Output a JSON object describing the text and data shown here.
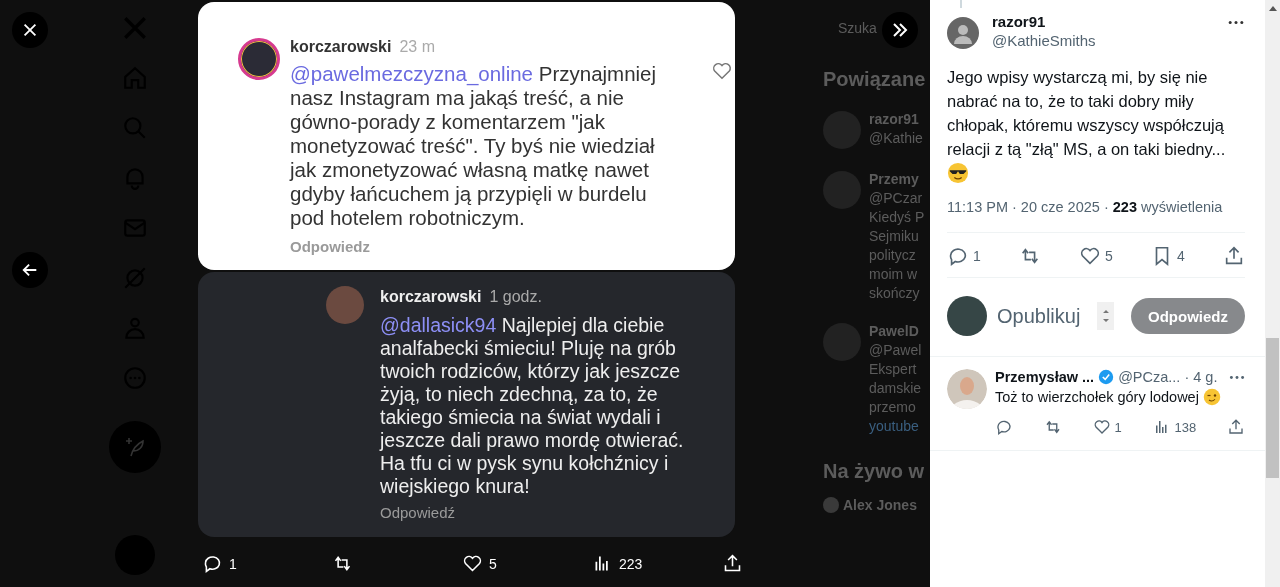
{
  "background": {
    "search_placeholder": "Szuka",
    "related_title": "Powiązane",
    "related": [
      {
        "name": "razor91",
        "handle": "@Kathie"
      },
      {
        "name": "Przemy",
        "handle": "@PCzar",
        "lines": [
          "Kiedyś P",
          "Sejmiku",
          "politycz",
          "moim w",
          "skończy"
        ]
      },
      {
        "name": "PawelD",
        "handle": "@Pawel",
        "lines": [
          "Ekspert",
          "damskie",
          "przemo"
        ],
        "link": "youtube"
      }
    ],
    "live_title": "Na żywo w",
    "live_name": "Alex Jones"
  },
  "media": {
    "comments": [
      {
        "kind": "light",
        "user": "korczarowski",
        "time": "23 m",
        "mention": "@pawelmezczyzna_online",
        "text": "Przynajmniej nasz Instagram ma jakąś treść, a nie gówno-porady z komentarzem \"jak monetyzować treść\". Ty byś nie wiedział jak zmonetyzować własną matkę nawet gdyby łańcuchem ją przypięli w burdelu pod hotelem robotniczym.",
        "reply": "Odpowiedz"
      },
      {
        "kind": "dark",
        "user": "korczarowski",
        "time": "1 godz.",
        "mention": "@dallasick94",
        "text": "Najlepiej dla ciebie analfabecki śmieciu! Pluję na grób twoich rodziców, którzy jak jeszcze żyją, to niech zdechną, za to, że takiego śmiecia na świat wydali i jeszcze dali prawo mordę otwierać. Ha tfu ci w pysk synu kołchźnicy i wiejskiego knura!",
        "reply": "Odpowiedź"
      }
    ],
    "actions": [
      {
        "kind": "reply",
        "count": "1"
      },
      {
        "kind": "repost"
      },
      {
        "kind": "like",
        "count": "5"
      },
      {
        "kind": "views",
        "count": "223"
      },
      {
        "kind": "share"
      }
    ]
  },
  "post": {
    "name": "razor91",
    "handle": "@KathieSmiths",
    "text": "Jego wpisy wystarczą mi, by się nie nabrać na to, że to taki dobry miły chłopak, któremu wszyscy współczują relacji z tą  \"złą\" MS, a on taki biedny...",
    "time": "11:13 PM · 20 cze 2025 · ",
    "views": "223",
    "views_label": "wyświetlenia",
    "actions": [
      {
        "kind": "reply",
        "count": "1"
      },
      {
        "kind": "repost"
      },
      {
        "kind": "like",
        "count": "5"
      },
      {
        "kind": "bookmark",
        "count": "4"
      },
      {
        "kind": "share"
      }
    ]
  },
  "composer": {
    "placeholder": "Opublikuj",
    "button": "Odpowiedz",
    "disabled": true
  },
  "replies": [
    {
      "name": "Przemysław ...",
      "verified": true,
      "handle": "@PCza...",
      "time": "· 4 g.",
      "text": "Toż to wierzchołek góry lodowej",
      "actions": [
        {
          "kind": "reply"
        },
        {
          "kind": "repost"
        },
        {
          "kind": "like",
          "count": "1"
        },
        {
          "kind": "views",
          "count": "138"
        },
        {
          "kind": "share"
        }
      ]
    }
  ]
}
